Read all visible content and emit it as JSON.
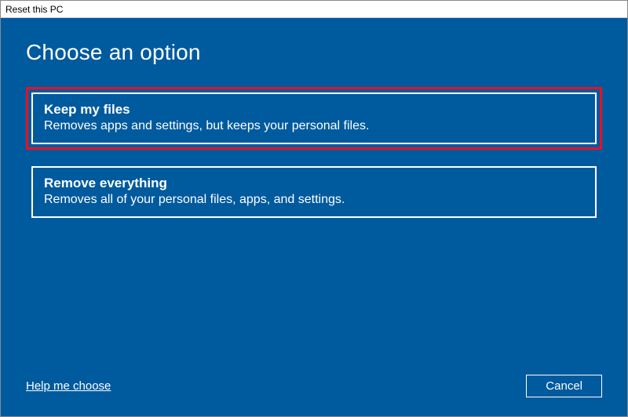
{
  "window": {
    "title": "Reset this PC"
  },
  "heading": "Choose an option",
  "options": [
    {
      "title": "Keep my files",
      "description": "Removes apps and settings, but keeps your personal files.",
      "highlighted": true
    },
    {
      "title": "Remove everything",
      "description": "Removes all of your personal files, apps, and settings.",
      "highlighted": false
    }
  ],
  "footer": {
    "help_link": "Help me choose",
    "cancel_label": "Cancel"
  }
}
